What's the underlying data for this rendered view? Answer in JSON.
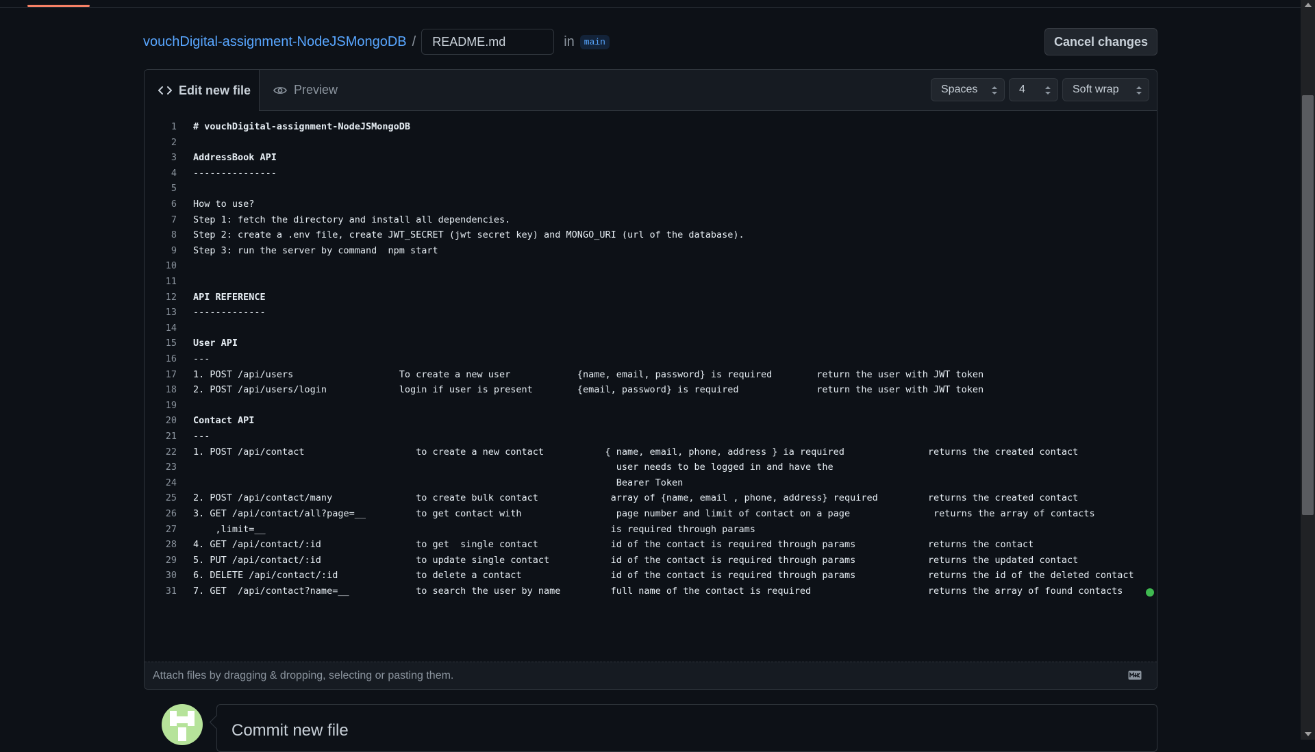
{
  "breadcrumb": {
    "repo": "vouchDigital-assignment-NodeJSMongoDB",
    "separator": "/",
    "filename": "README.md",
    "in_text": "in",
    "branch": "main"
  },
  "actions": {
    "cancel": "Cancel changes"
  },
  "editor": {
    "tab_edit": "Edit new file",
    "tab_preview": "Preview",
    "indent_mode": "Spaces",
    "indent_size": "4",
    "wrap_mode": "Soft wrap",
    "lines": [
      "# vouchDigital-assignment-NodeJSMongoDB",
      "",
      "AddressBook API",
      "---------------",
      "",
      "How to use?",
      "Step 1: fetch the directory and install all dependencies.",
      "Step 2: create a .env file, create JWT_SECRET (jwt secret key) and MONGO_URI (url of the database).",
      "Step 3: run the server by command  npm start",
      "",
      "",
      "API REFERENCE",
      "-------------",
      "",
      "User API",
      "---",
      "1. POST /api/users                   To create a new user            {name, email, password} is required        return the user with JWT token",
      "2. POST /api/users/login             login if user is present        {email, password} is required              return the user with JWT token",
      "",
      "Contact API",
      "---",
      "1. POST /api/contact                    to create a new contact           { name, email, phone, address } ia required               returns the created contact",
      "                                                                            user needs to be logged in and have the",
      "                                                                            Bearer Token",
      "2. POST /api/contact/many               to create bulk contact             array of {name, email , phone, address} required         returns the created contact",
      "3. GET /api/contact/all?page=__         to get contact with                 page number and limit of contact on a page               returns the array of contacts",
      "    ,limit=__                                                              is required through params",
      "4. GET /api/contact/:id                 to get  single contact             id of the contact is required through params             returns the contact",
      "5. PUT /api/contact/:id                 to update single contact           id of the contact is required through params             returns the updated contact",
      "6. DELETE /api/contact/:id              to delete a contact                id of the contact is required through params             returns the id of the deleted contact",
      "7. GET  /api/contact?name=__            to search the user by name         full name of the contact is required                     returns the array of found contacts"
    ]
  },
  "attach_bar": {
    "text": "Attach files by dragging & dropping, selecting or pasting them."
  },
  "commit": {
    "title": "Commit new file"
  },
  "colors": {
    "accent": "#58a6ff",
    "status_dot": "#3fb950",
    "tab_underline": "#f78166",
    "avatar_bg": "#b6e39a"
  }
}
